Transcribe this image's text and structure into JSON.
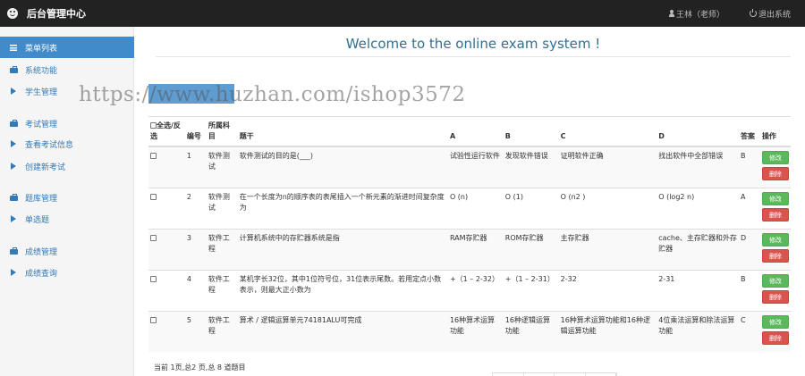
{
  "topbar": {
    "brand": "后台管理中心",
    "user": "王林（老师）",
    "logout": "退出系统"
  },
  "sidebar": {
    "items": [
      {
        "label": "菜单列表",
        "icon": "list-icon"
      },
      {
        "label": "系统功能",
        "icon": "briefcase-icon"
      },
      {
        "label": "学生管理",
        "icon": "play-icon"
      },
      {
        "label": "考试管理",
        "icon": "briefcase-icon"
      },
      {
        "label": "查看考试信息",
        "icon": "play-icon"
      },
      {
        "label": "创建新考试",
        "icon": "play-icon"
      },
      {
        "label": "题库管理",
        "icon": "briefcase-icon"
      },
      {
        "label": "单选题",
        "icon": "play-icon"
      },
      {
        "label": "成绩管理",
        "icon": "briefcase-icon"
      },
      {
        "label": "成绩查询",
        "icon": "play-icon"
      }
    ]
  },
  "main": {
    "welcome": "Welcome to the online exam system !"
  },
  "table": {
    "headers": {
      "select": "全选/反选",
      "num": "编号",
      "subject": "所属科目",
      "question": "题干",
      "a": "A",
      "b": "B",
      "c": "C",
      "d": "D",
      "answer": "答案",
      "ops": "操作"
    },
    "edit_label": "修改",
    "delete_label": "删除",
    "rows": [
      {
        "num": "1",
        "subject": "软件测试",
        "question": "软件测试的目的是(___)",
        "a": "试验性运行软件",
        "b": "发现软件错误",
        "c": "证明软件正确",
        "d": "找出软件中全部错误",
        "answer": "B"
      },
      {
        "num": "2",
        "subject": "软件测试",
        "question": "在一个长度为n的顺序表的表尾插入一个新元素的渐进时间复杂度为",
        "a": "O (n)",
        "b": "O (1)",
        "c": "O (n2 )",
        "d": "O (log2 n)",
        "answer": "A"
      },
      {
        "num": "3",
        "subject": "软件工程",
        "question": "计算机系统中的存贮器系统是指",
        "a": "RAM存贮器",
        "b": "ROM存贮器",
        "c": "主存贮器",
        "d": "cache、主存贮器和外存贮器",
        "answer": "D"
      },
      {
        "num": "4",
        "subject": "软件工程",
        "question": "某机字长32位，其中1位符号位，31位表示尾数。若用定点小数表示，则最大正小数为",
        "a": "+（1 – 2-32）",
        "b": "+（1 – 2-31）",
        "c": "2-32",
        "d": "2-31",
        "answer": "B"
      },
      {
        "num": "5",
        "subject": "软件工程",
        "question": "算术 / 逻辑运算单元74181ALU可完成",
        "a": "16种算术运算功能",
        "b": "16种逻辑运算功能",
        "c": "16种算术运算功能和16种逻辑运算功能",
        "d": "4位乘法运算和除法运算功能",
        "answer": "C"
      }
    ]
  },
  "footer": {
    "pagination_info": "当前 1页,总2 页,总 8 道题目"
  },
  "watermark": {
    "text": "https://www.huzhan.com/ishop3572"
  }
}
